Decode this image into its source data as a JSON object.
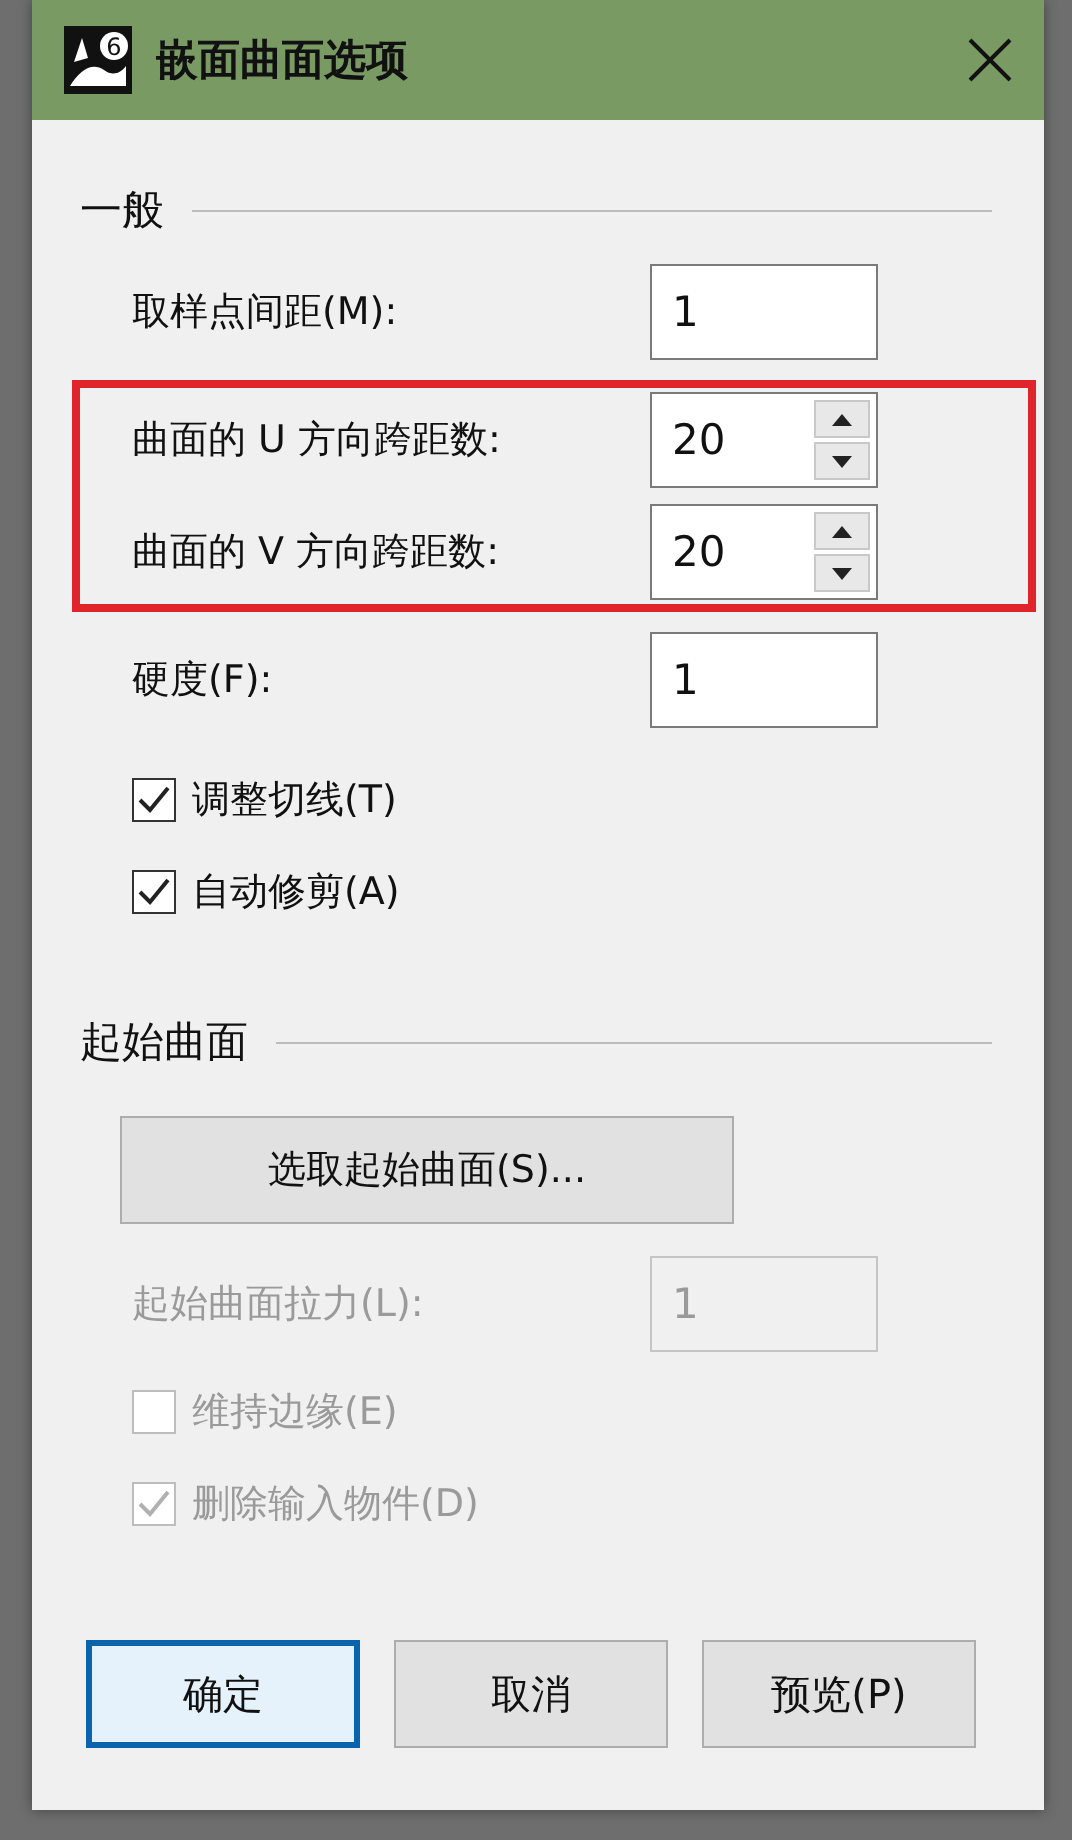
{
  "window": {
    "title": "嵌面曲面选项",
    "icon_badge": "6"
  },
  "general": {
    "heading": "一般",
    "fields": [
      {
        "kind": "text",
        "label": "取样点间距(M):",
        "value": "1",
        "highlighted": false,
        "disabled": false
      },
      {
        "kind": "spin",
        "label": "曲面的 U 方向跨距数:",
        "value": "20",
        "highlighted": true,
        "disabled": false
      },
      {
        "kind": "spin",
        "label": "曲面的 V 方向跨距数:",
        "value": "20",
        "highlighted": true,
        "disabled": false
      },
      {
        "kind": "text",
        "label": "硬度(F):",
        "value": "1",
        "highlighted": false,
        "disabled": false
      }
    ],
    "checkboxes": [
      {
        "label": "调整切线(T)",
        "checked": true,
        "disabled": false
      },
      {
        "label": "自动修剪(A)",
        "checked": true,
        "disabled": false
      }
    ]
  },
  "start_surface": {
    "heading": "起始曲面",
    "select_button": "选取起始曲面(S)...",
    "fields": [
      {
        "kind": "text",
        "label": "起始曲面拉力(L):",
        "value": "1",
        "disabled": true
      }
    ],
    "checkboxes": [
      {
        "label": "维持边缘(E)",
        "checked": false,
        "disabled": true
      },
      {
        "label": "删除输入物件(D)",
        "checked": true,
        "disabled": true
      }
    ]
  },
  "buttons": [
    {
      "label": "确定",
      "default": true
    },
    {
      "label": "取消",
      "default": false
    },
    {
      "label": "预览(P)",
      "default": false
    }
  ]
}
